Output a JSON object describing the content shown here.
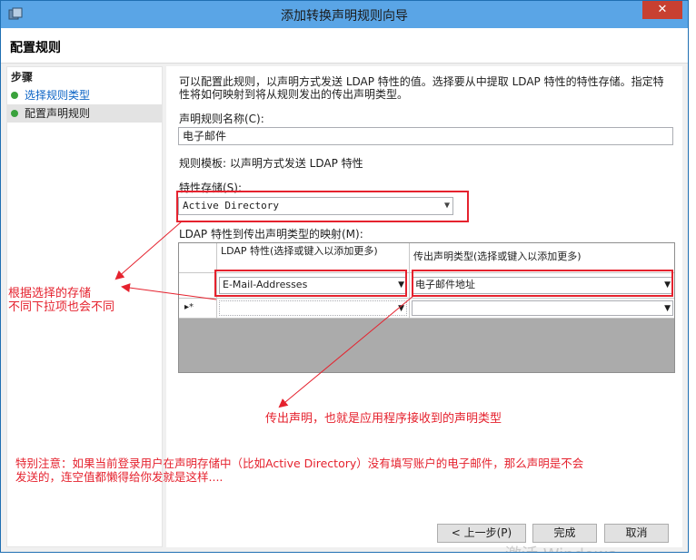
{
  "window": {
    "title": "添加转换声明规则向导",
    "close_glyph": "✕"
  },
  "header": {
    "page_title": "配置规则"
  },
  "steps": {
    "title": "步骤",
    "items": [
      {
        "label": "选择规则类型"
      },
      {
        "label": "配置声明规则"
      }
    ]
  },
  "main": {
    "description": "可以配置此规则，以声明方式发送 LDAP 特性的值。选择要从中提取 LDAP 特性的特性存储。指定特性将如何映射到将从规则发出的传出声明类型。",
    "rule_name_label": "声明规则名称(C):",
    "rule_name_value": "电子邮件",
    "rule_template": "规则模板: 以声明方式发送 LDAP 特性",
    "attribute_store_label": "特性存储(S):",
    "attribute_store_value": "Active Directory",
    "mapping_label": "LDAP 特性到传出声明类型的映射(M):",
    "grid": {
      "col1_header": "LDAP 特性(选择或键入以添加更多)",
      "col2_header": "传出声明类型(选择或键入以添加更多)",
      "rows": [
        {
          "ldap": "E-Mail-Addresses",
          "claim": "电子邮件地址"
        }
      ],
      "new_row_marker": "▸*"
    }
  },
  "buttons": {
    "back": "< 上一步(P)",
    "finish": "完成",
    "cancel": "取消"
  },
  "annotations": {
    "store_note_line1": "根据选择的存储",
    "store_note_line2": "不同下拉项也会不同",
    "claim_note": "传出声明，也就是应用程序接收到的声明类型",
    "special_note_line1": "特别注意：如果当前登录用户在声明存储中（比如Active Directory）没有填写账户的电子邮件，那么声明是不会",
    "special_note_line2": "发送的，连空值都懒得给你发就是这样...."
  },
  "watermark": "激活 Windows",
  "colors": {
    "annotation": "#e5222e",
    "titlebar": "#5aa5e6",
    "close": "#c84031",
    "link": "#0b63c5"
  }
}
